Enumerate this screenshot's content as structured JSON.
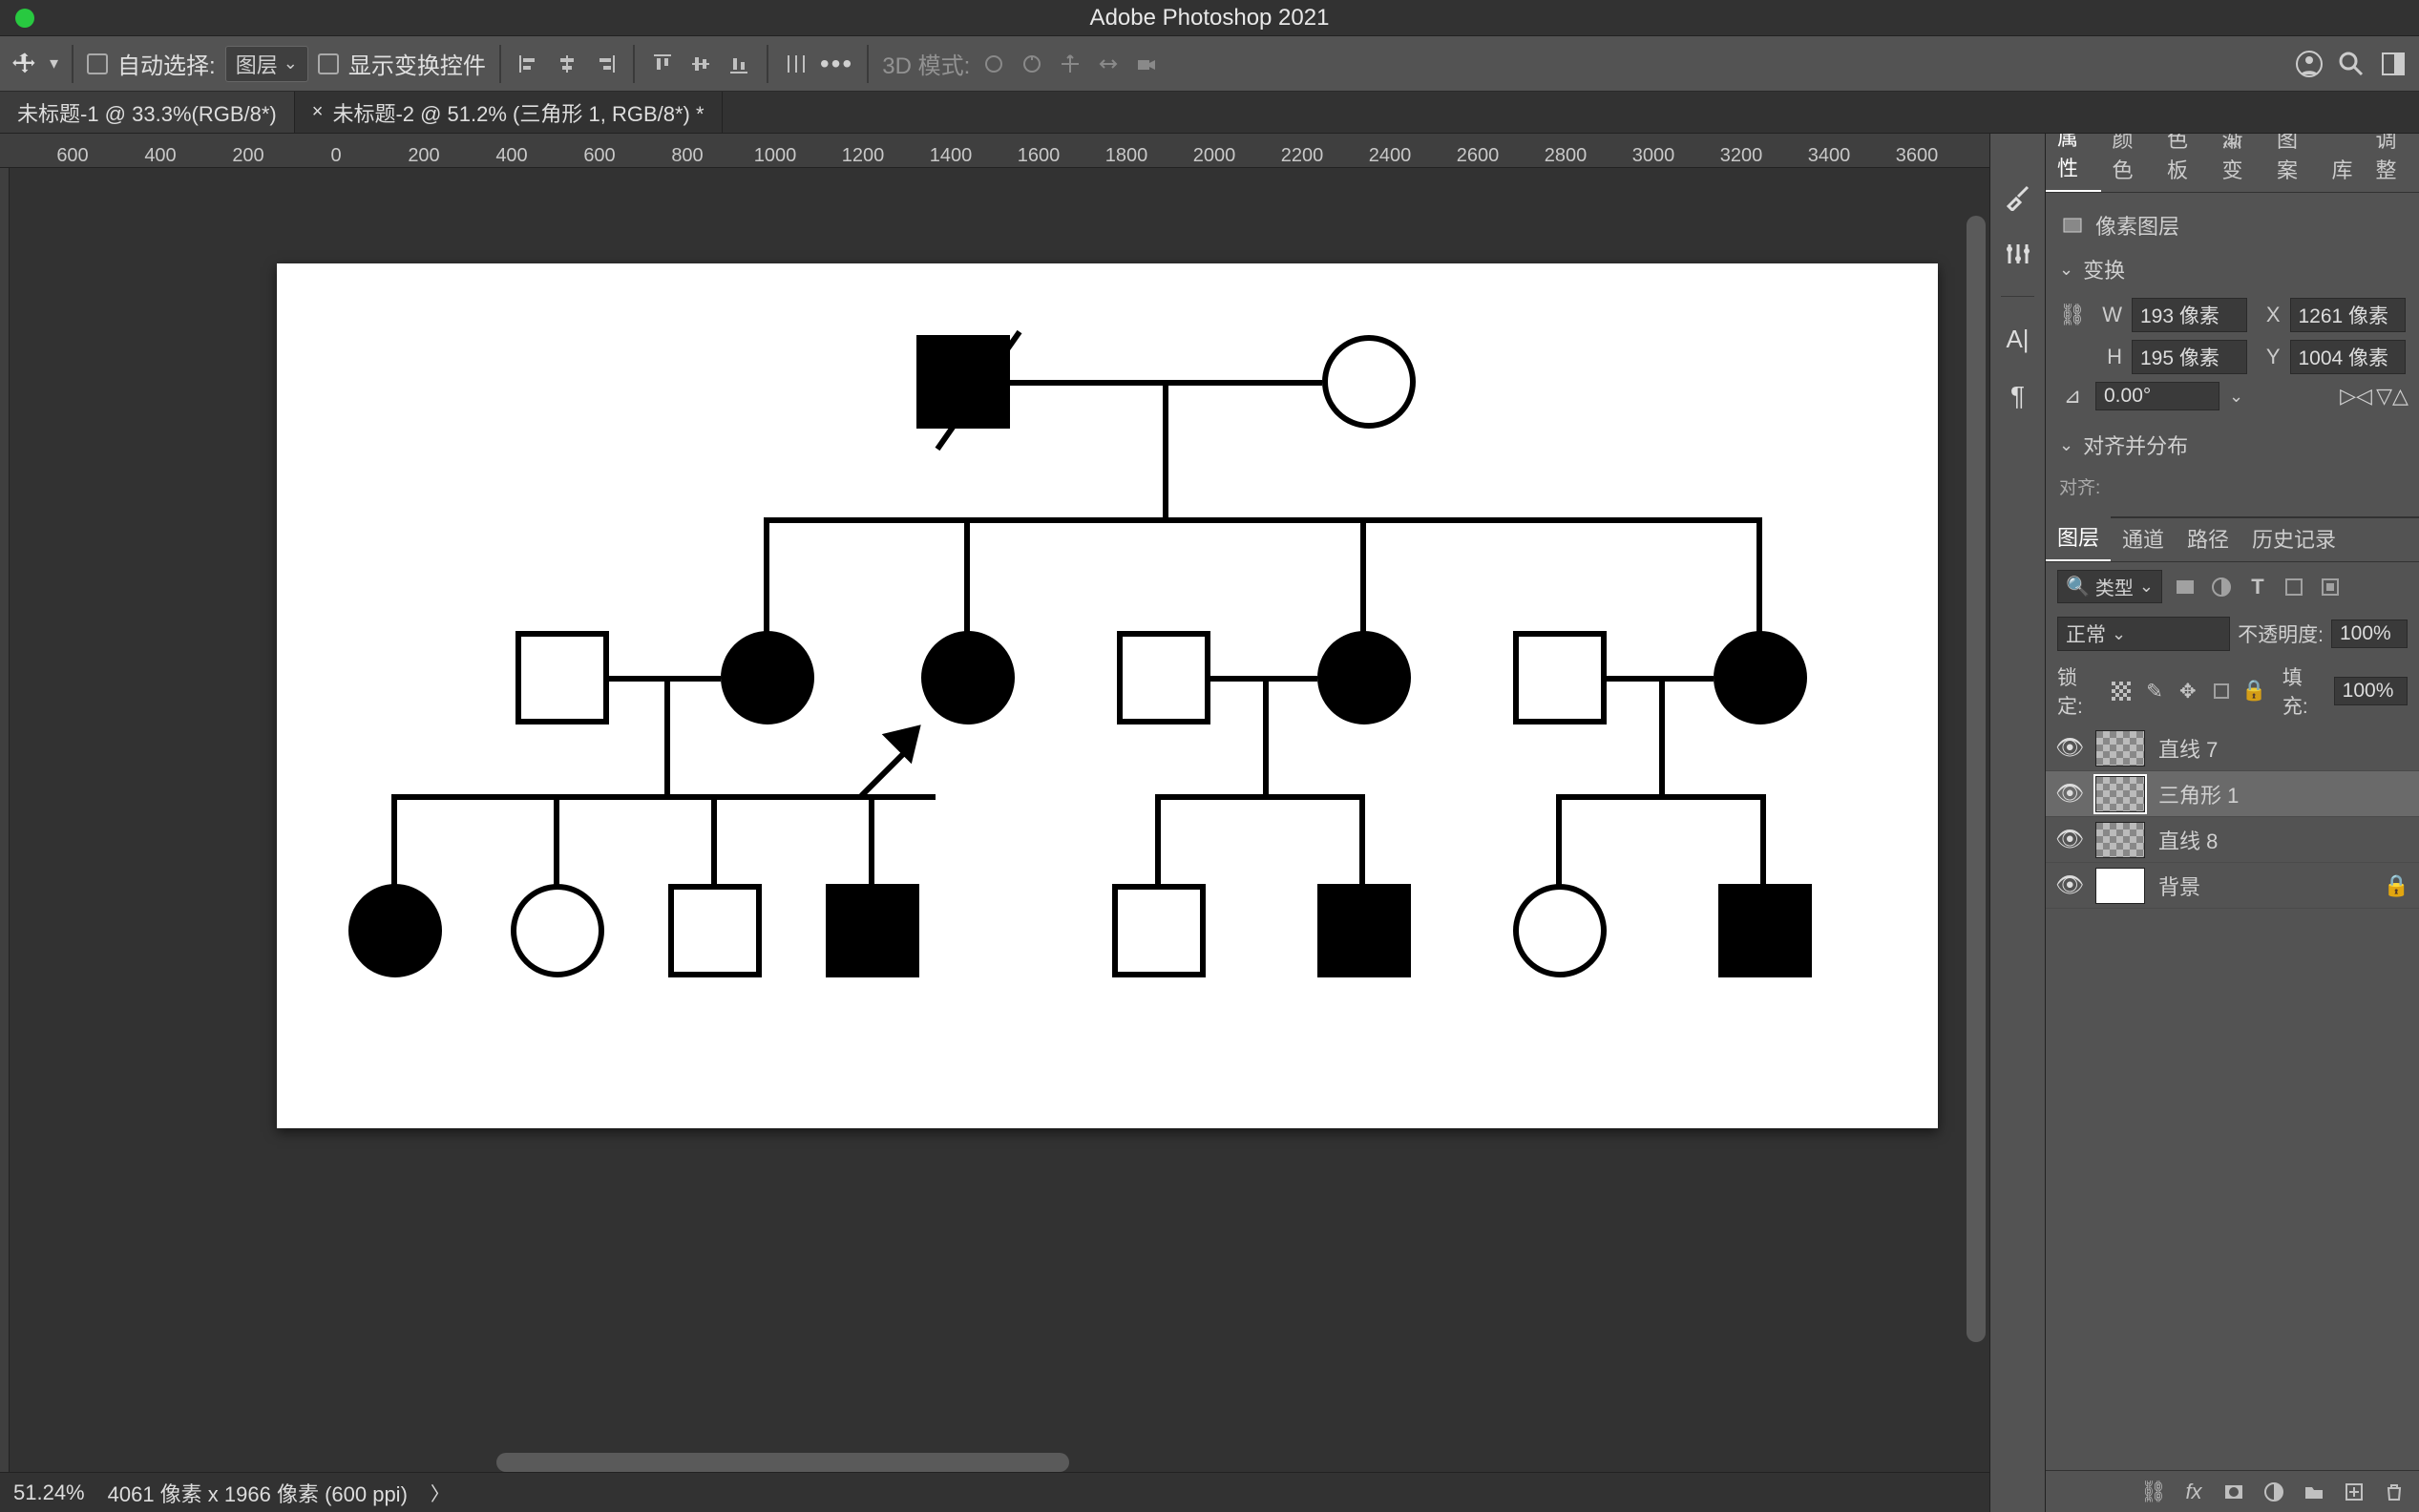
{
  "app_title": "Adobe Photoshop 2021",
  "optionsbar": {
    "auto_select_label": "自动选择:",
    "auto_select_target": "图层",
    "show_transform_label": "显示变换控件",
    "mode3d_label": "3D 模式:"
  },
  "tabs": [
    {
      "title": "未标题-1 @ 33.3%(RGB/8*)",
      "active": false
    },
    {
      "title": "未标题-2 @ 51.2% (三角形 1, RGB/8*) *",
      "active": true
    }
  ],
  "ruler_ticks": [
    "600",
    "400",
    "200",
    "0",
    "200",
    "400",
    "600",
    "800",
    "1000",
    "1200",
    "1400",
    "1600",
    "1800",
    "2000",
    "2200",
    "2400",
    "2600",
    "2800",
    "3000",
    "3200",
    "3400",
    "3600"
  ],
  "statusbar": {
    "zoom": "51.24%",
    "docinfo": "4061 像素 x 1966 像素 (600 ppi)"
  },
  "properties_panel": {
    "tabs": [
      "属性",
      "颜色",
      "色板",
      "渐变",
      "图案",
      "库",
      "调整"
    ],
    "layer_kind": "像素图层",
    "transform_label": "变换",
    "W_label": "W",
    "W_value": "193 像素",
    "H_label": "H",
    "H_value": "195 像素",
    "X_label": "X",
    "X_value": "1261 像素",
    "Y_label": "Y",
    "Y_value": "1004 像素",
    "angle_value": "0.00°",
    "align_label": "对齐并分布",
    "align_sub": "对齐:"
  },
  "layers_panel": {
    "tabs": [
      "图层",
      "通道",
      "路径",
      "历史记录"
    ],
    "kind_label": "类型",
    "blend_mode": "正常",
    "opacity_label": "不透明度:",
    "opacity_value": "100%",
    "lock_label": "锁定:",
    "fill_label": "填充:",
    "fill_value": "100%",
    "layers": [
      {
        "name": "直线 7",
        "selected": false,
        "thumb": "checker"
      },
      {
        "name": "三角形 1",
        "selected": true,
        "thumb": "checker"
      },
      {
        "name": "直线 8",
        "selected": false,
        "thumb": "checker"
      },
      {
        "name": "背景",
        "selected": false,
        "thumb": "white"
      }
    ]
  }
}
